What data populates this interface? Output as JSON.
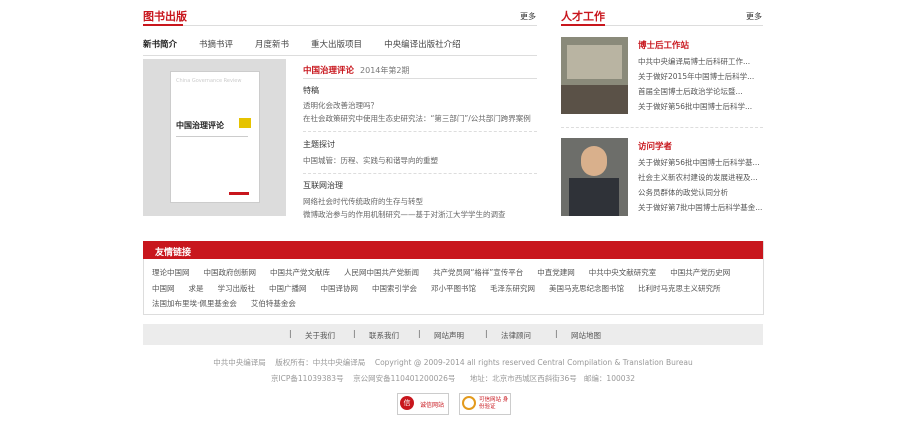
{
  "left": {
    "title": "图书出版",
    "more": "更多",
    "tabs": [
      "新书简介",
      "书摘书评",
      "月度新书",
      "重大出版项目",
      "中央编译出版社介绍"
    ],
    "cover": {
      "en_title": "China Governance Review",
      "cn_title": "中国治理评论"
    },
    "magazine": {
      "title": "中国治理评论",
      "issue": "2014年第2期"
    },
    "sections": [
      {
        "cat": "特稿",
        "lines": [
          "透明化会改善治理吗？",
          "在社会政策研究中使用生态史研究法：“第三部门”/公共部门跨界案例"
        ]
      },
      {
        "cat": "主题探讨",
        "lines": [
          "中国城管：历程、实践与和谐导向的重塑"
        ]
      },
      {
        "cat": "互联网治理",
        "lines": [
          "网络社会时代传统政府的生存与转型",
          "微博政治参与的作用机制研究——基于对浙江大学学生的调查"
        ]
      }
    ]
  },
  "right": {
    "title": "人才工作",
    "more": "更多",
    "block1": {
      "heading": "博士后工作站",
      "items": [
        "中共中央编译局博士后科研工作...",
        "关于做好2015年中国博士后科学...",
        "首届全国博士后政治学论坛暨...",
        "关于做好第56批中国博士后科学..."
      ]
    },
    "block2": {
      "heading": "访问学者",
      "items": [
        "关于做好第56批中国博士后科学基...",
        "社会主义新农村建设的发展进程及...",
        "公务员群体的政党认同分析",
        "关于做好第7批中国博士后科学基金..."
      ]
    }
  },
  "friends": {
    "title": "友情链接",
    "rows": [
      [
        "理论中国网",
        "中国政府创新网",
        "中国共产党文献库",
        "人民网中国共产党新闻",
        "共产党员网“格祥”宣传平台",
        "中直党建网",
        "中共中央文献研究室",
        "中国共产党历史网"
      ],
      [
        "中国网",
        "求是",
        "学习出版社",
        "中国广播网",
        "中国译协网",
        "中国索引学会",
        "邓小平图书馆",
        "毛泽东研究网",
        "美国马克思纪念图书馆",
        "比利时马克思主义研究所"
      ],
      [
        "法国加布里埃·佩里基金会",
        "艾伯特基金会"
      ]
    ]
  },
  "footer": {
    "nav": [
      "关于我们",
      "联系我们",
      "网站声明",
      "法律顾问",
      "网站地图"
    ],
    "line1": [
      "中共中央编译局",
      "版权所有：中共中央编译局",
      "Copyright @ 2009-2014   all rights reserved Central Compilation & Translation Bureau"
    ],
    "line2": [
      "京ICP备11039383号",
      "京公网安备110401200026号",
      "地址：北京市西城区西斜街36号",
      "邮编：100032"
    ],
    "badges": [
      "诚信网站",
      "可信网站 身份验证"
    ]
  }
}
